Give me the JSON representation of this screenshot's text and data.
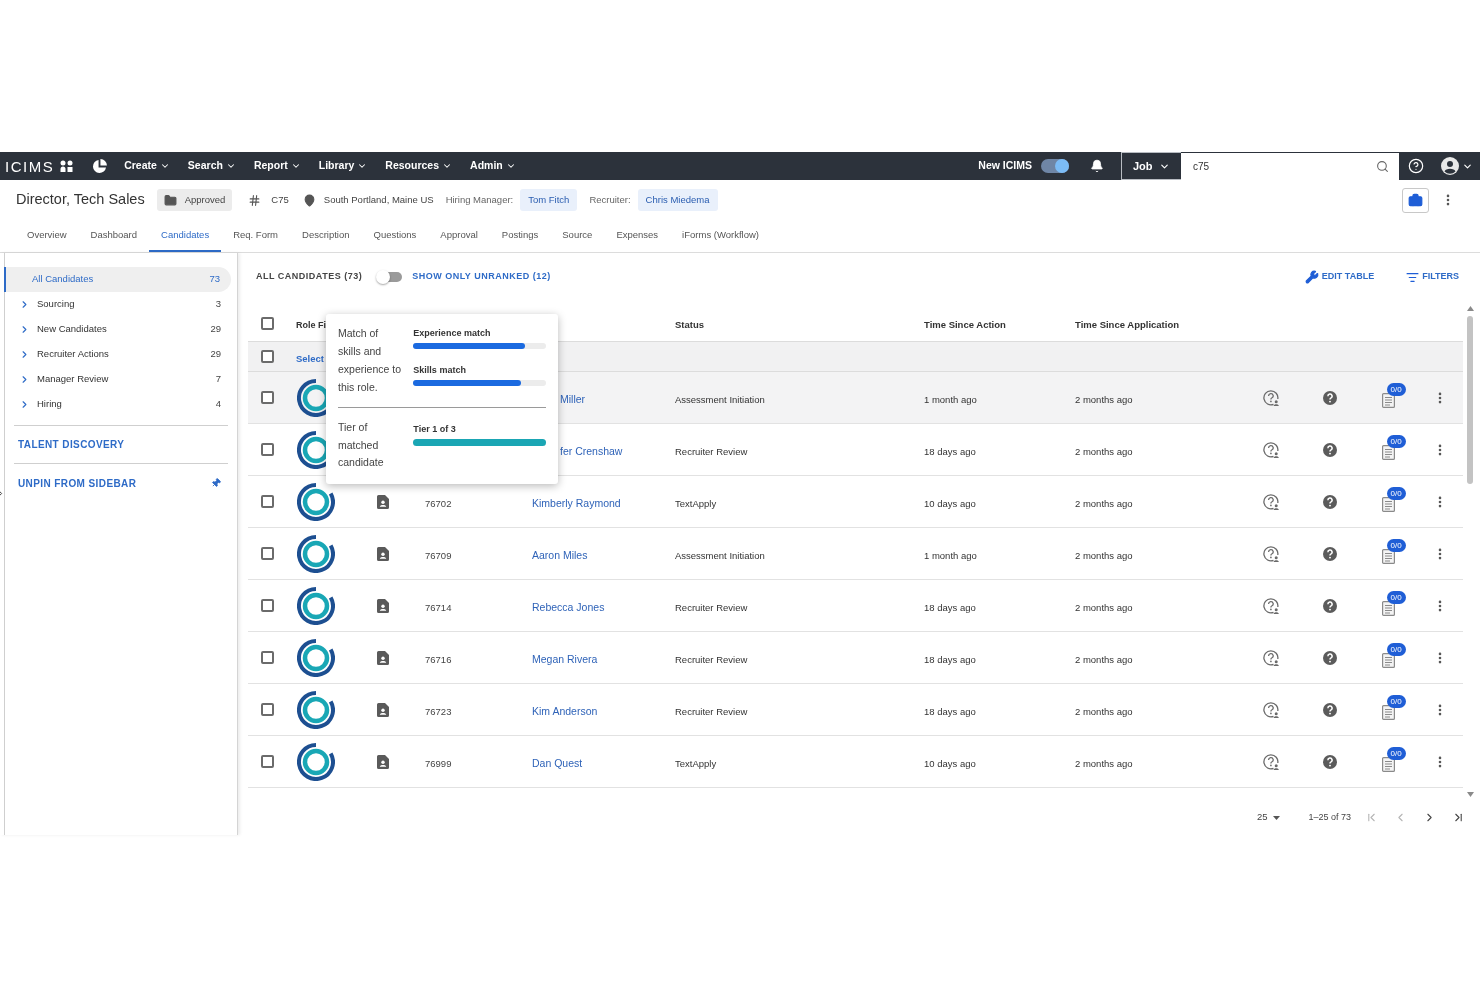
{
  "top_nav": {
    "logo": "ICIMS",
    "menus": [
      {
        "label": "Create"
      },
      {
        "label": "Search"
      },
      {
        "label": "Report"
      },
      {
        "label": "Library"
      },
      {
        "label": "Resources"
      },
      {
        "label": "Admin"
      }
    ],
    "new_icims": {
      "label": "New ICIMS",
      "on": true
    },
    "search_scope": "Job",
    "search": {
      "value": "c75"
    }
  },
  "job_header": {
    "title": "Director, Tech Sales",
    "status": "Approved",
    "job_id": "C75",
    "location": "South Portland, Maine US",
    "hiring_manager": {
      "label": "Hiring Manager:",
      "name": "Tom Fitch"
    },
    "recruiter": {
      "label": "Recruiter:",
      "name": "Chris Miedema"
    }
  },
  "tabs": [
    {
      "label": "Overview",
      "selected": false
    },
    {
      "label": "Dashboard",
      "selected": false
    },
    {
      "label": "Candidates",
      "selected": true
    },
    {
      "label": "Req. Form",
      "selected": false
    },
    {
      "label": "Description",
      "selected": false
    },
    {
      "label": "Questions",
      "selected": false
    },
    {
      "label": "Approval",
      "selected": false
    },
    {
      "label": "Postings",
      "selected": false
    },
    {
      "label": "Source",
      "selected": false
    },
    {
      "label": "Expenses",
      "selected": false
    },
    {
      "label": "iForms (Workflow)",
      "selected": false
    }
  ],
  "sidebar": {
    "items": [
      {
        "label": "All Candidates",
        "count": "73",
        "selected": true,
        "expandable": false
      },
      {
        "label": "Sourcing",
        "count": "3",
        "selected": false,
        "expandable": true
      },
      {
        "label": "New Candidates",
        "count": "29",
        "selected": false,
        "expandable": true
      },
      {
        "label": "Recruiter Actions",
        "count": "29",
        "selected": false,
        "expandable": true
      },
      {
        "label": "Manager Review",
        "count": "7",
        "selected": false,
        "expandable": true
      },
      {
        "label": "Hiring",
        "count": "4",
        "selected": false,
        "expandable": true
      }
    ],
    "talent_discovery": "TALENT DISCOVERY",
    "unpin": "UNPIN FROM SIDEBAR"
  },
  "toolbar": {
    "title": "ALL CANDIDATES (73)",
    "unranked_toggle": {
      "label": "SHOW ONLY UNRANKED (12)",
      "on": false
    },
    "actions": [
      {
        "kind": "edit",
        "label": "EDIT TABLE"
      },
      {
        "kind": "filter",
        "label": "FILTERS"
      }
    ]
  },
  "table": {
    "header_checkbox": {
      "checked": false
    },
    "columns": [
      "Role Fi",
      "Status",
      "Time Since Action",
      "Time Since Application"
    ],
    "select_row": {
      "label": "Select",
      "checked": false
    },
    "rows": [
      {
        "name": "Miller",
        "status": "Assessment Initiation",
        "time_since_action": "1 month ago",
        "time_since_application": "2 months ago",
        "badge": "0/0",
        "checked": false,
        "highlighted": true,
        "covered": true
      },
      {
        "name": "fer Crenshaw",
        "status": "Recruiter Review",
        "time_since_action": "18 days ago",
        "time_since_application": "2 months ago",
        "badge": "0/0",
        "checked": false,
        "highlighted": false,
        "covered": true
      },
      {
        "id": "76702",
        "name": "Kimberly Raymond",
        "status": "TextApply",
        "time_since_action": "10 days ago",
        "time_since_application": "2 months ago",
        "badge": "0/0",
        "checked": false,
        "highlighted": false,
        "covered": false
      },
      {
        "id": "76709",
        "name": "Aaron Miles",
        "status": "Assessment Initiation",
        "time_since_action": "1 month ago",
        "time_since_application": "2 months ago",
        "badge": "0/0",
        "checked": false,
        "highlighted": false,
        "covered": false
      },
      {
        "id": "76714",
        "name": "Rebecca Jones",
        "status": "Recruiter Review",
        "time_since_action": "18 days ago",
        "time_since_application": "2 months ago",
        "badge": "0/0",
        "checked": false,
        "highlighted": false,
        "covered": false
      },
      {
        "id": "76716",
        "name": "Megan Rivera",
        "status": "Recruiter Review",
        "time_since_action": "18 days ago",
        "time_since_application": "2 months ago",
        "badge": "0/0",
        "checked": false,
        "highlighted": false,
        "covered": false
      },
      {
        "id": "76723",
        "name": "Kim Anderson",
        "status": "Recruiter Review",
        "time_since_action": "18 days ago",
        "time_since_application": "2 months ago",
        "badge": "0/0",
        "checked": false,
        "highlighted": false,
        "covered": false
      },
      {
        "id": "76999",
        "name": "Dan Quest",
        "status": "TextApply",
        "time_since_action": "10 days ago",
        "time_since_application": "2 months ago",
        "badge": "0/0",
        "checked": false,
        "highlighted": false,
        "covered": false
      }
    ]
  },
  "match_tooltip": {
    "description": "Match of skills and experience to this role.",
    "meters": [
      {
        "label": "Experience match",
        "level": 0.84
      },
      {
        "label": "Skills match",
        "level": 0.81
      }
    ],
    "tier": {
      "description": "Tier of matched candidate",
      "label": "Tier 1 of 3",
      "level": 1
    }
  },
  "pagination": {
    "page_size": "25",
    "range": "1–25 of 73",
    "buttons": [
      {
        "kind": "first",
        "disabled": true
      },
      {
        "kind": "prev",
        "disabled": true
      },
      {
        "kind": "next",
        "disabled": false
      },
      {
        "kind": "last",
        "disabled": false
      }
    ]
  }
}
